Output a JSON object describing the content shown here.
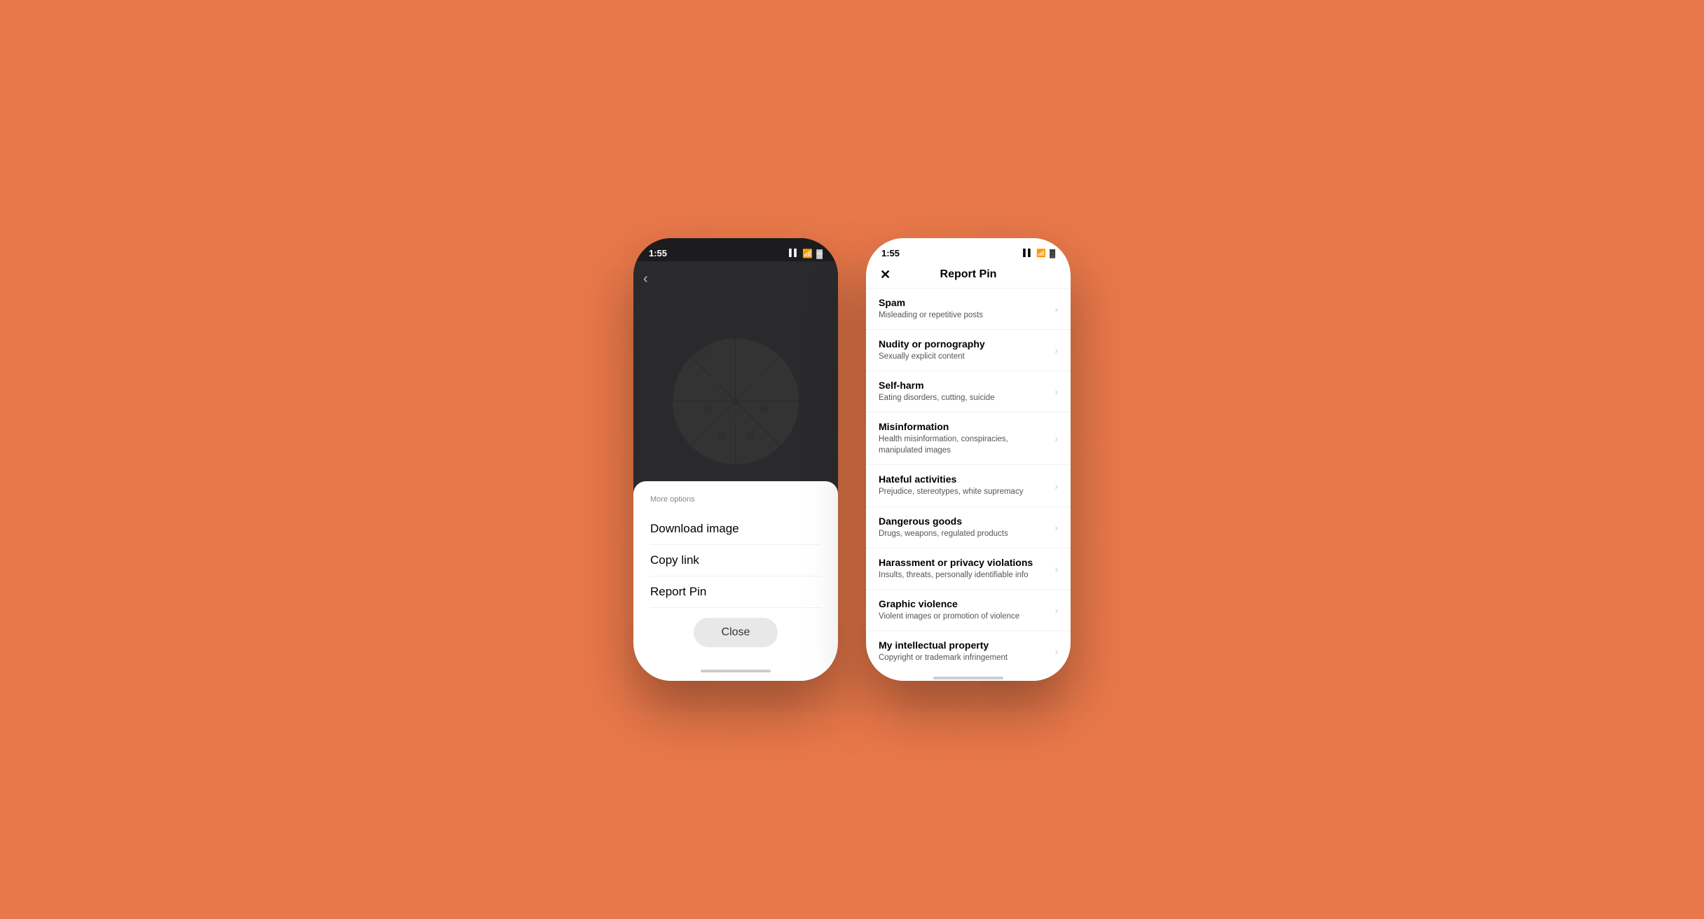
{
  "background_color": "#E8784A",
  "left_phone": {
    "status": {
      "time": "1:55",
      "time_icon": "location-arrow-icon"
    },
    "more_options_label": "More options",
    "menu_items": [
      {
        "label": "Download image"
      },
      {
        "label": "Copy link"
      },
      {
        "label": "Report Pin"
      }
    ],
    "close_button_label": "Close"
  },
  "right_phone": {
    "status": {
      "time": "1:55",
      "time_icon": "location-arrow-icon"
    },
    "header": {
      "close_label": "✕",
      "title": "Report Pin"
    },
    "report_items": [
      {
        "title": "Spam",
        "description": "Misleading or repetitive posts"
      },
      {
        "title": "Nudity or pornography",
        "description": "Sexually explicit content"
      },
      {
        "title": "Self-harm",
        "description": "Eating disorders, cutting, suicide"
      },
      {
        "title": "Misinformation",
        "description": "Health misinformation, conspiracies, manipulated images"
      },
      {
        "title": "Hateful activities",
        "description": "Prejudice, stereotypes, white supremacy"
      },
      {
        "title": "Dangerous goods",
        "description": "Drugs, weapons, regulated products"
      },
      {
        "title": "Harassment or privacy violations",
        "description": "Insults, threats, personally identifiable info"
      },
      {
        "title": "Graphic violence",
        "description": "Violent images or promotion of violence"
      },
      {
        "title": "My intellectual property",
        "description": "Copyright or trademark infringement"
      }
    ]
  }
}
